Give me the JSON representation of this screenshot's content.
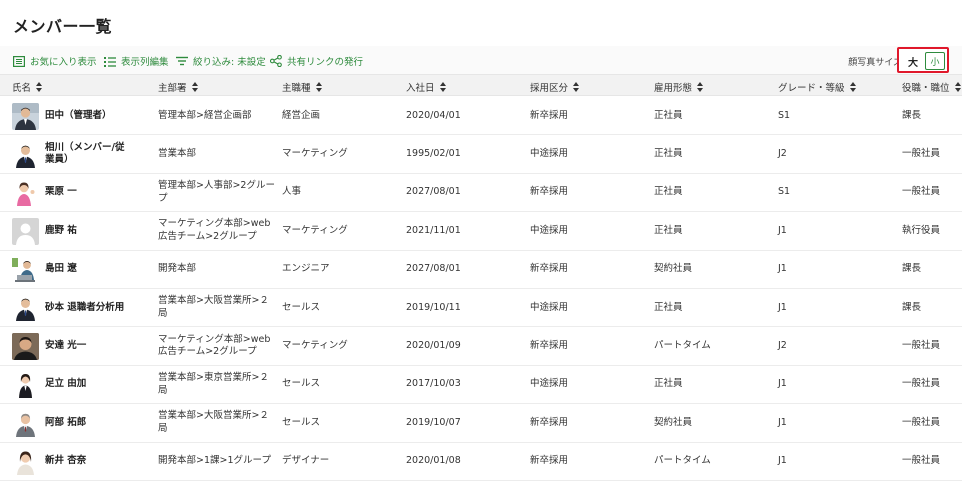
{
  "page": {
    "title": "メンバー一覧"
  },
  "toolbar": {
    "favorites": "お気に入り表示",
    "columns": "表示列編集",
    "filter": "絞り込み: 未設定",
    "share": "共有リンクの発行",
    "photo_size_label": "顔写真サイズ",
    "size_large": "大",
    "size_small": "小"
  },
  "colors": {
    "accent": "#2e8b3d",
    "highlight": "#e0182b"
  },
  "columns": [
    "氏名",
    "主部署",
    "主職種",
    "入社日",
    "採用区分",
    "雇用形態",
    "グレード・等級",
    "役職・職位"
  ],
  "members": [
    {
      "name": "田中（管理者）",
      "dept": "管理本部>経営企画部",
      "job": "経営企画",
      "joined": "2020/04/01",
      "hire_type": "新卒採用",
      "employment": "正社員",
      "grade": "S1",
      "role": "課長",
      "avatar": "man-suit-office"
    },
    {
      "name": "相川（メンバー/従業員）",
      "dept": "営業本部",
      "job": "マーケティング",
      "joined": "1995/02/01",
      "hire_type": "中途採用",
      "employment": "正社員",
      "grade": "J2",
      "role": "一般社員",
      "avatar": "man-suit"
    },
    {
      "name": "栗原 一",
      "dept": "管理本部>人事部>2グループ",
      "job": "人事",
      "joined": "2027/08/01",
      "hire_type": "新卒採用",
      "employment": "正社員",
      "grade": "S1",
      "role": "一般社員",
      "avatar": "woman-pink"
    },
    {
      "name": "鹿野 祐",
      "dept": "マーケティング本部>web広告チーム>2グループ",
      "job": "マーケティング",
      "joined": "2021/11/01",
      "hire_type": "中途採用",
      "employment": "正社員",
      "grade": "J1",
      "role": "執行役員",
      "avatar": "placeholder"
    },
    {
      "name": "島田 遼",
      "dept": "開発本部",
      "job": "エンジニア",
      "joined": "2027/08/01",
      "hire_type": "新卒採用",
      "employment": "契約社員",
      "grade": "J1",
      "role": "課長",
      "avatar": "man-laptop"
    },
    {
      "name": "砂本 退職者分析用",
      "dept": "営業本部>大阪営業所>２局",
      "job": "セールス",
      "joined": "2019/10/11",
      "hire_type": "中途採用",
      "employment": "正社員",
      "grade": "J1",
      "role": "課長",
      "avatar": "man-suit"
    },
    {
      "name": "安達 光一",
      "dept": "マーケティング本部>web広告チーム>2グループ",
      "job": "マーケティング",
      "joined": "2020/01/09",
      "hire_type": "新卒採用",
      "employment": "パートタイム",
      "grade": "J2",
      "role": "一般社員",
      "avatar": "man-casual"
    },
    {
      "name": "足立 由加",
      "dept": "営業本部>東京営業所>２局",
      "job": "セールス",
      "joined": "2017/10/03",
      "hire_type": "中途採用",
      "employment": "正社員",
      "grade": "J1",
      "role": "一般社員",
      "avatar": "woman-suit"
    },
    {
      "name": "阿部 拓郎",
      "dept": "営業本部>大阪営業所>２局",
      "job": "セールス",
      "joined": "2019/10/07",
      "hire_type": "新卒採用",
      "employment": "契約社員",
      "grade": "J1",
      "role": "一般社員",
      "avatar": "man-older"
    },
    {
      "name": "新井 杏奈",
      "dept": "開発本部>1課>1グループ",
      "job": "デザイナー",
      "joined": "2020/01/08",
      "hire_type": "新卒採用",
      "employment": "パートタイム",
      "grade": "J1",
      "role": "一般社員",
      "avatar": "woman-casual"
    }
  ]
}
